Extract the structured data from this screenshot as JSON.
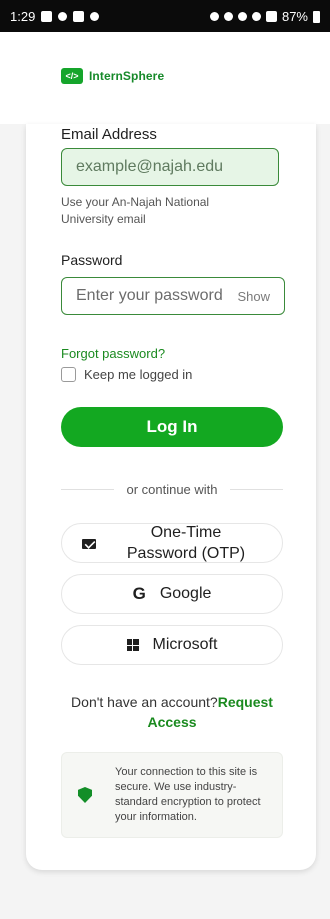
{
  "status_bar": {
    "time": "1:29",
    "battery": "87%"
  },
  "header": {
    "logo_glyph": "</>",
    "logo_text": "InternSphere",
    "accent": "#13a821"
  },
  "login_form": {
    "email": {
      "label": "Email Address",
      "placeholder": "example@najah.edu",
      "helper": "Use your An-Najah National University email"
    },
    "password": {
      "label": "Password",
      "placeholder": "Enter your password",
      "show_label": "Show"
    },
    "forgot_password": "Forgot password?",
    "keep_logged_in": "Keep me logged in",
    "login_button": "Log In",
    "divider_text": "or continue with"
  },
  "alternatives": [
    {
      "label": "One-Time Password (OTP)",
      "icon": "envelope-icon"
    },
    {
      "label": "Google",
      "icon": "google-icon"
    },
    {
      "label": "Microsoft",
      "icon": "microsoft-icon"
    }
  ],
  "signup": {
    "prompt": "Don't have an account?",
    "link": "Request Access"
  },
  "security_note": {
    "icon": "shield-icon",
    "text": "Your connection to this site is secure. We use industry-standard encryption to protect your information."
  }
}
